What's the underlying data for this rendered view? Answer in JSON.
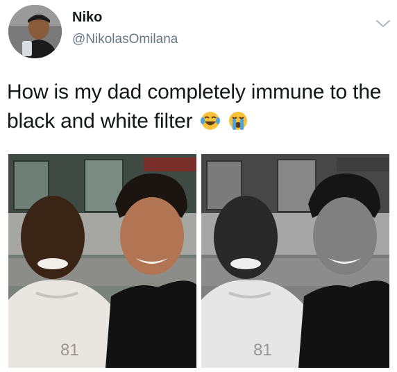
{
  "tweet": {
    "author": {
      "display_name": "Niko",
      "handle": "@NikolasOmilana",
      "avatar_icon": "profile-photo"
    },
    "menu_icon": "chevron-down-icon",
    "text": "How is my dad completely immune to the black and white filter",
    "emojis": [
      "face-with-tears-of-joy-icon",
      "loudly-crying-face-icon"
    ],
    "photos": [
      {
        "label": "color-photo",
        "filter": "none"
      },
      {
        "label": "black-and-white-photo",
        "filter": "grayscale"
      }
    ],
    "shirt_print": "81",
    "colors": {
      "handle": "#657786",
      "text": "#14171a",
      "emoji_yellow": "#f7c23a",
      "tear_blue": "#4aa3df"
    }
  }
}
